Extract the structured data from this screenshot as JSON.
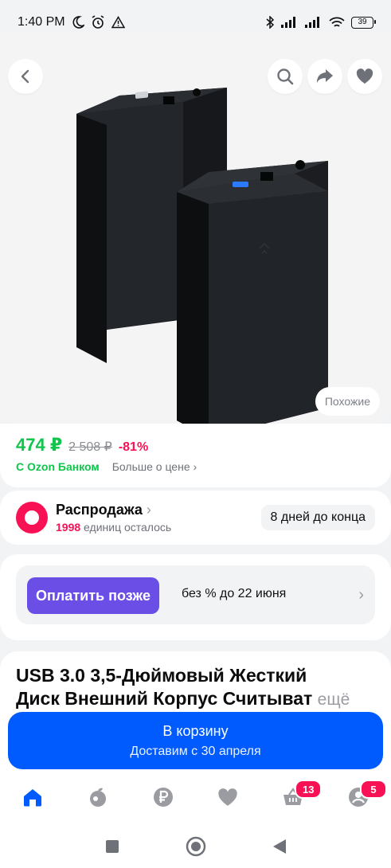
{
  "status_bar": {
    "time": "1:40 PM",
    "battery": "39"
  },
  "gallery": {
    "similar_label": "Похожие"
  },
  "price": {
    "current": "474 ₽",
    "old": "2 508 ₽",
    "discount": "-81%",
    "bank_label": "С Ozon Банком",
    "more_label": "Больше о цене ›"
  },
  "sale": {
    "title": "Распродажа",
    "chevron": "›",
    "count": "1998",
    "count_suffix": "единиц осталось",
    "days_left": "8 дней до конца"
  },
  "pay_later": {
    "button_label": "Оплатить позже",
    "description": "без % до 22 июня",
    "chevron": "›"
  },
  "product": {
    "title_line1": "USB 3.0 3,5-Дюймовый Жесткий",
    "title_line2": "Диск Внешний Корпус Считыват",
    "more_link": "ещё"
  },
  "cart_button": {
    "label": "В корзину",
    "delivery": "Доставим с 30 апреля"
  },
  "tab_bar": {
    "items": [
      {
        "icon": "home-icon"
      },
      {
        "icon": "fresh-icon"
      },
      {
        "icon": "ruble-icon"
      },
      {
        "icon": "favorites-icon"
      },
      {
        "icon": "cart-icon",
        "badge": "13"
      },
      {
        "icon": "profile-icon",
        "badge": "5"
      }
    ]
  },
  "colors": {
    "brand_blue": "#005bff",
    "price_green": "#10c44c",
    "sale_pink": "#f91155",
    "pay_purple": "#6b4ee6"
  }
}
